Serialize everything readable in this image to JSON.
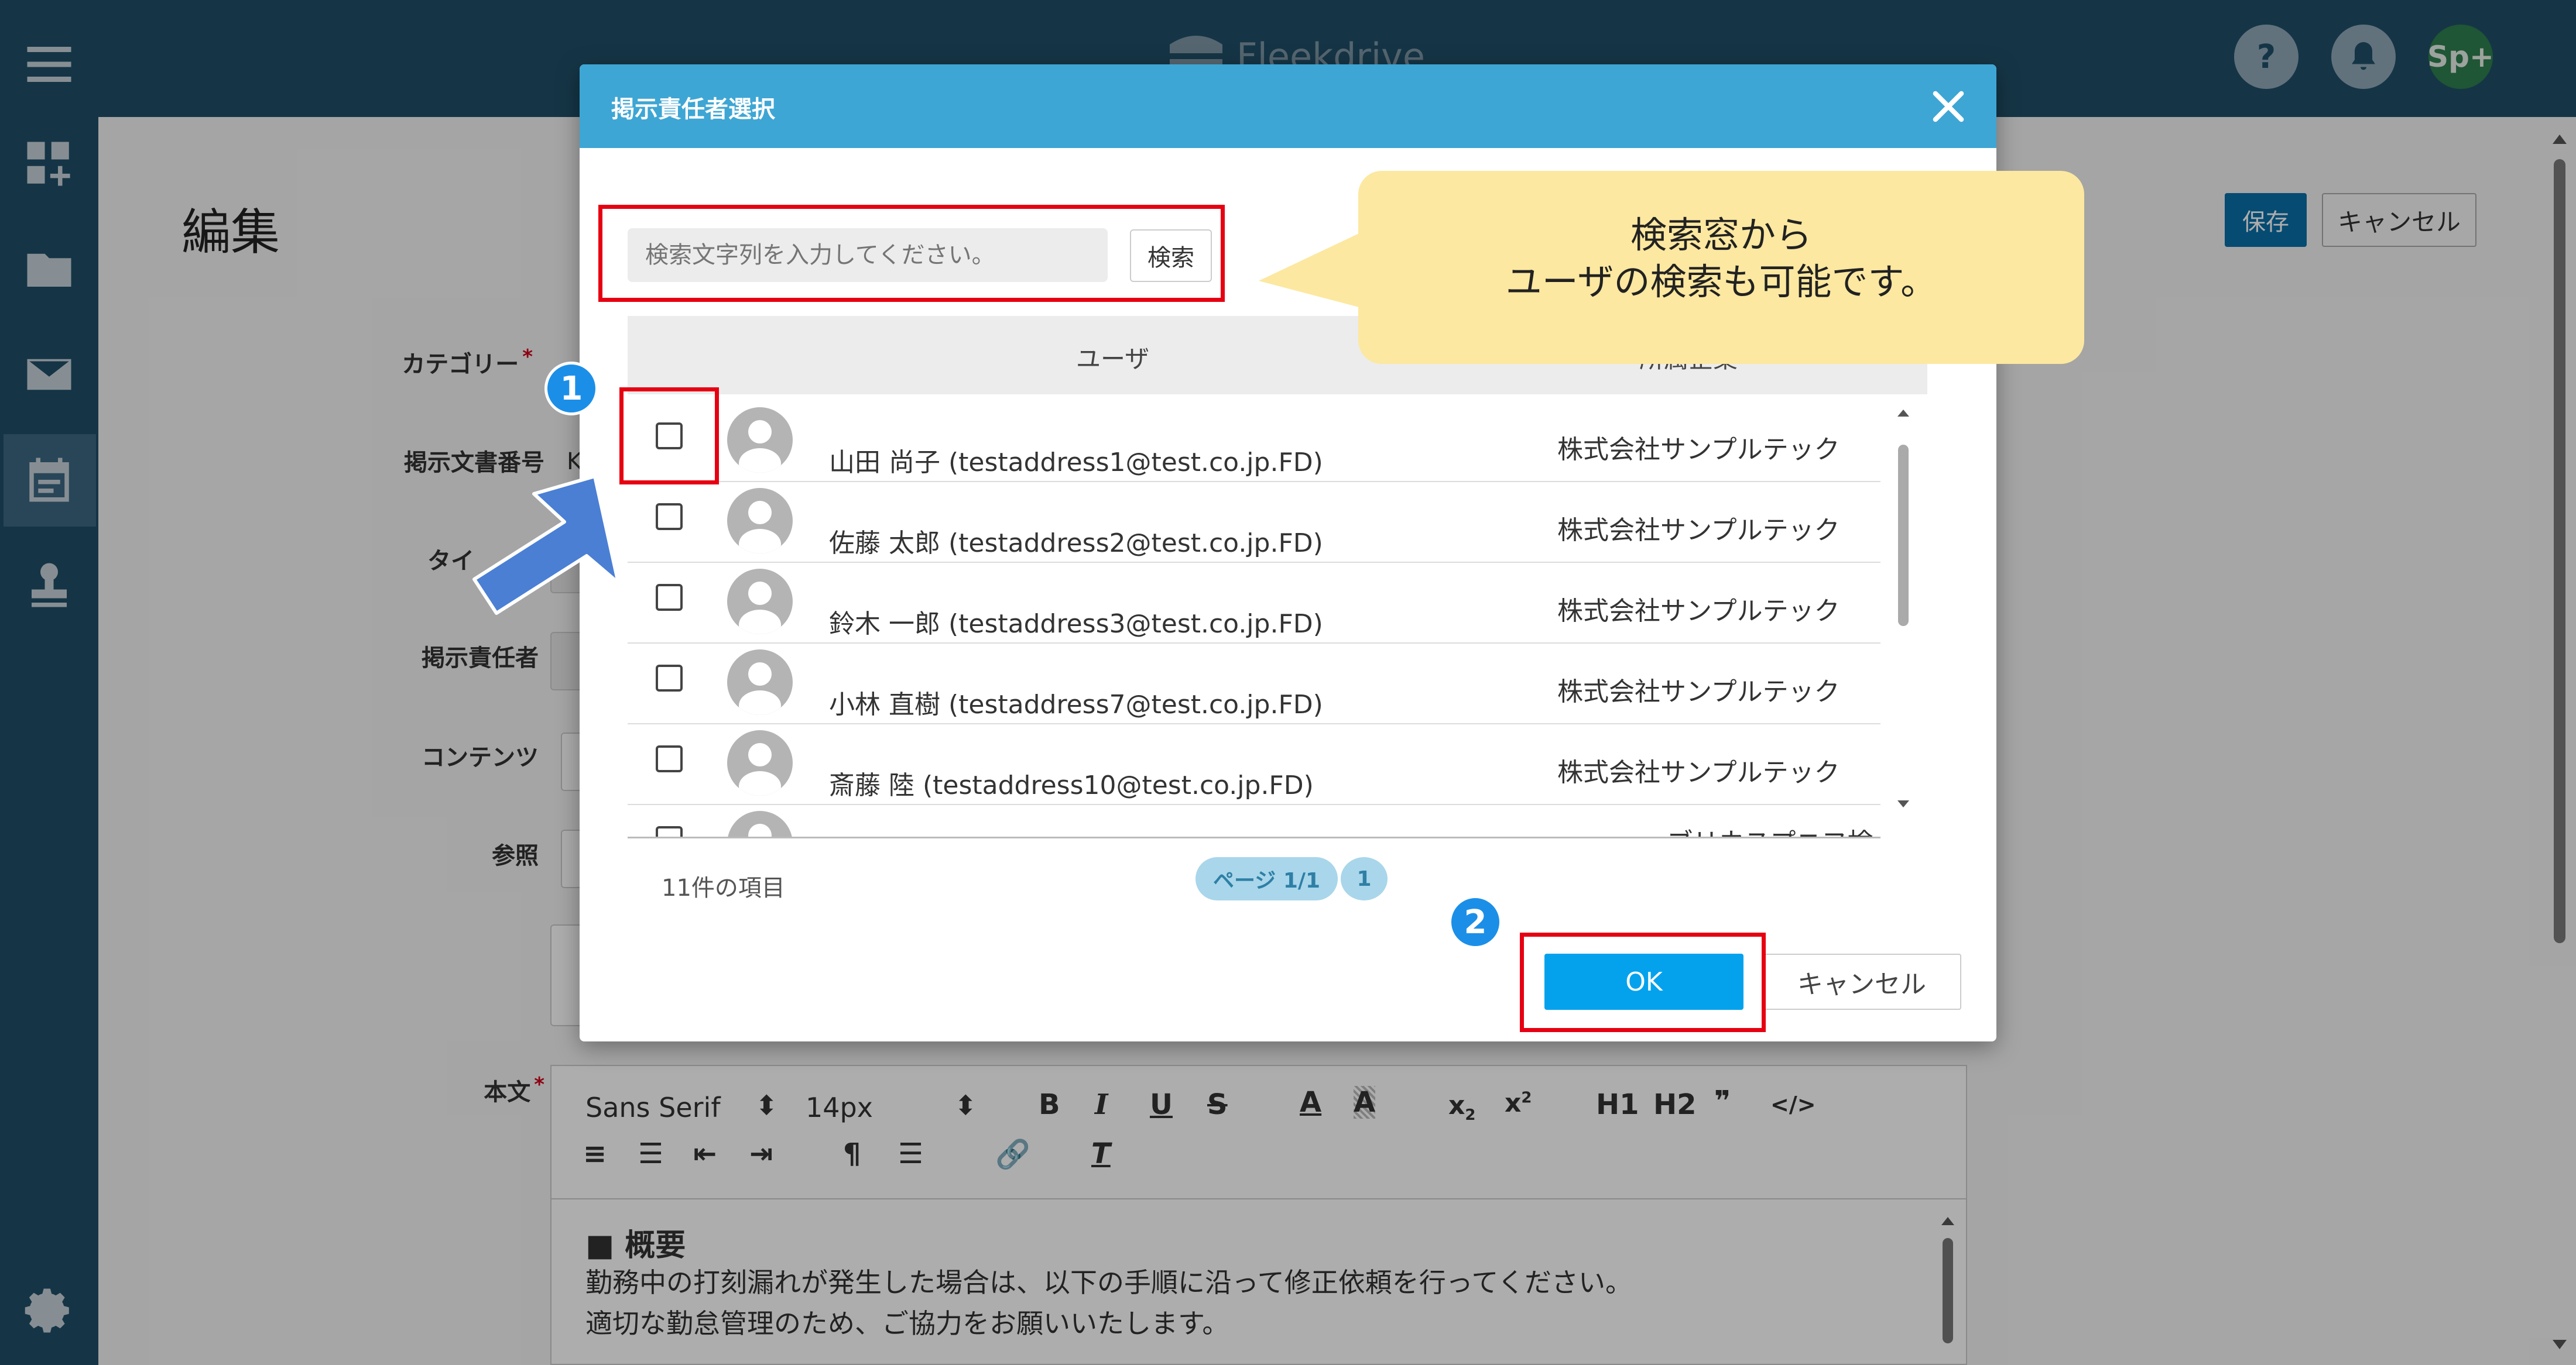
{
  "app": {
    "brand": "Fleekdrive",
    "user_badge": "Sp+",
    "help_label": "?"
  },
  "page": {
    "title": "編集",
    "save_label": "保存",
    "cancel_label": "キャンセル",
    "labels": {
      "category": "カテゴリー",
      "doc_number": "掲示文書番号",
      "title": "タイ",
      "responsible": "掲示責任者",
      "contents": "コンテンツ",
      "reference": "参照",
      "body": "本文"
    },
    "required_mark": "*",
    "doc_number_frag": "K"
  },
  "editor": {
    "font": "Sans Serif",
    "size": "14px",
    "h1": "H1",
    "h2": "H2",
    "quote": "❞",
    "code": "</>",
    "heading": "■ 概要",
    "line1": "勤務中の打刻漏れが発生した場合は、以下の手順に沿って修正依頼を行ってください。",
    "line2": "適切な勤怠管理のため、ご協力をお願いいたします。"
  },
  "modal": {
    "title": "掲示責任者選択",
    "search_placeholder": "検索文字列を入力してください。",
    "search_button": "検索",
    "columns": [
      "ユーザ",
      "所属企業"
    ],
    "rows": [
      {
        "name": "山田 尚子 (testaddress1@test.co.jp.FD)",
        "company": "株式会社サンプルテック"
      },
      {
        "name": "佐藤 太郎 (testaddress2@test.co.jp.FD)",
        "company": "株式会社サンプルテック"
      },
      {
        "name": "鈴木 一郎 (testaddress3@test.co.jp.FD)",
        "company": "株式会社サンプルテック"
      },
      {
        "name": "小林 直樹 (testaddress7@test.co.jp.FD)",
        "company": "株式会社サンプルテック"
      },
      {
        "name": "斎藤 陸 (testaddress10@test.co.jp.FD)",
        "company": "株式会社サンプルテック"
      }
    ],
    "partial_company": "・・・ ーブリウスプニフ検証",
    "item_count": "11件の項目",
    "page_label": "ページ 1/1",
    "page_number": "1",
    "ok_label": "OK",
    "cancel_label": "キャンセル"
  },
  "annotations": {
    "step1": "1",
    "step2": "2",
    "callout_line1": "検索窓から",
    "callout_line2": "ユーザの検索も可能です。"
  },
  "colors": {
    "header": "#1f4e68",
    "modal_header": "#3ea6d4",
    "ok_button": "#04a2ed",
    "highlight": "#e60012",
    "badge": "#1b8fe8",
    "callout": "#fce8a0",
    "arrow": "#4a7fd4"
  }
}
